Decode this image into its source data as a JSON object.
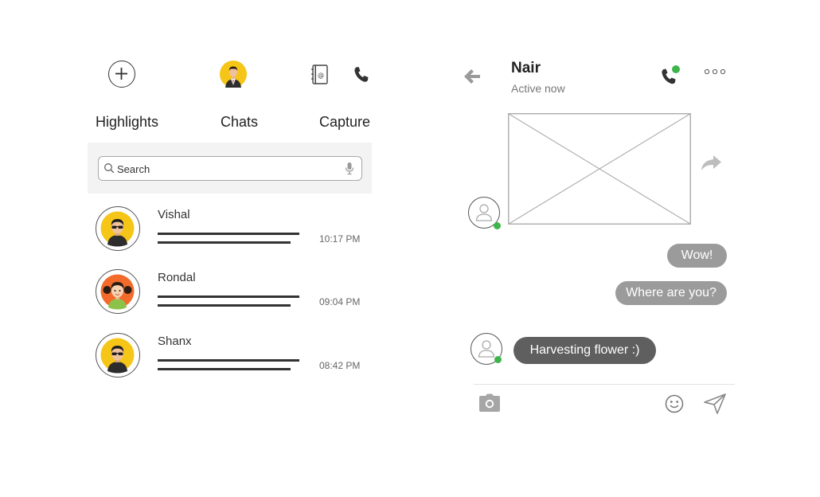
{
  "left_panel": {
    "tabs": [
      {
        "label": "Highlights"
      },
      {
        "label": "Chats"
      },
      {
        "label": "Capture"
      }
    ],
    "search": {
      "placeholder": "Search"
    },
    "chats": [
      {
        "name": "Vishal",
        "time": "10:17 PM",
        "avatar": "man-sunglasses-yellow"
      },
      {
        "name": "Rondal",
        "time": "09:04 PM",
        "avatar": "girl-pigtails-orange"
      },
      {
        "name": "Shanx",
        "time": "08:42 PM",
        "avatar": "man-sunglasses-yellow"
      }
    ]
  },
  "conversation": {
    "contact_name": "Nair",
    "status": "Active now",
    "messages": [
      {
        "type": "image",
        "direction": "incoming"
      },
      {
        "type": "text",
        "direction": "outgoing",
        "text": "Wow!"
      },
      {
        "type": "text",
        "direction": "outgoing",
        "text": "Where are you?"
      },
      {
        "type": "text",
        "direction": "incoming",
        "text": "Harvesting flower :)"
      }
    ]
  },
  "icons": {
    "add": "plus-circle-icon",
    "contacts": "address-book-icon",
    "phone": "phone-icon",
    "search": "search-icon",
    "mic": "microphone-icon",
    "back": "arrow-left-icon",
    "call_active": "phone-online-icon",
    "more": "more-horizontal-icon",
    "share": "share-arrow-icon",
    "camera": "camera-icon",
    "emoji": "emoji-icon",
    "send": "send-icon"
  },
  "colors": {
    "online": "#3db54a",
    "outgoing_bubble": "#9b9b9b",
    "incoming_bubble": "#5f5f5f",
    "avatar_yellow": "#f5c518",
    "avatar_orange": "#f26b2a",
    "search_band": "#f3f3f3"
  }
}
